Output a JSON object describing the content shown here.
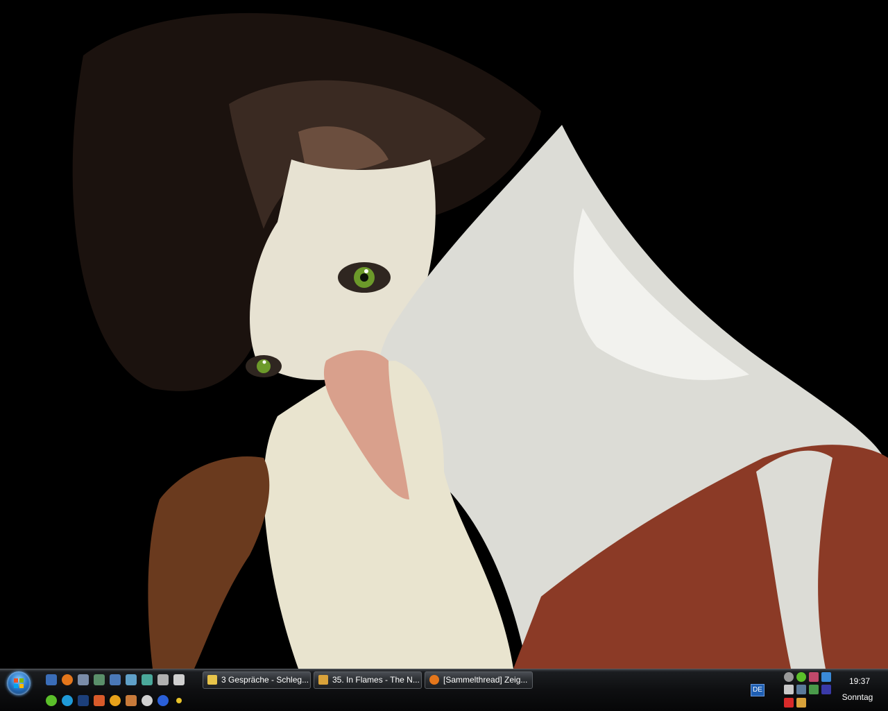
{
  "taskbar": {
    "tasks": [
      {
        "label": "3 Gespräche - Schleg...",
        "icon": "messenger-folder-icon",
        "color": "#e8c44a"
      },
      {
        "label": "35. In Flames - The N...",
        "icon": "winamp-icon",
        "color": "#d9a23a"
      },
      {
        "label": "[Sammelthread] Zeig...",
        "icon": "firefox-icon",
        "color": "#e4761b"
      }
    ],
    "language": "DE",
    "clock": {
      "time": "19:37",
      "day": "Sonntag"
    }
  },
  "quick_launch": [
    "show-desktop-icon",
    "firefox-icon",
    "thunderbird-icon",
    "notepad-icon",
    "computer-icon",
    "network-icon",
    "recycle-icon",
    "skull-icon",
    "skull2-icon",
    "icq-icon",
    "skype-icon",
    "photoshop-icon",
    "paint-icon",
    "info-icon",
    "tool-icon",
    "disc-icon",
    "steam-icon",
    "dots-icon"
  ],
  "colors": {
    "accent": "#2a78c8",
    "taskbar": "#0e0f11"
  }
}
